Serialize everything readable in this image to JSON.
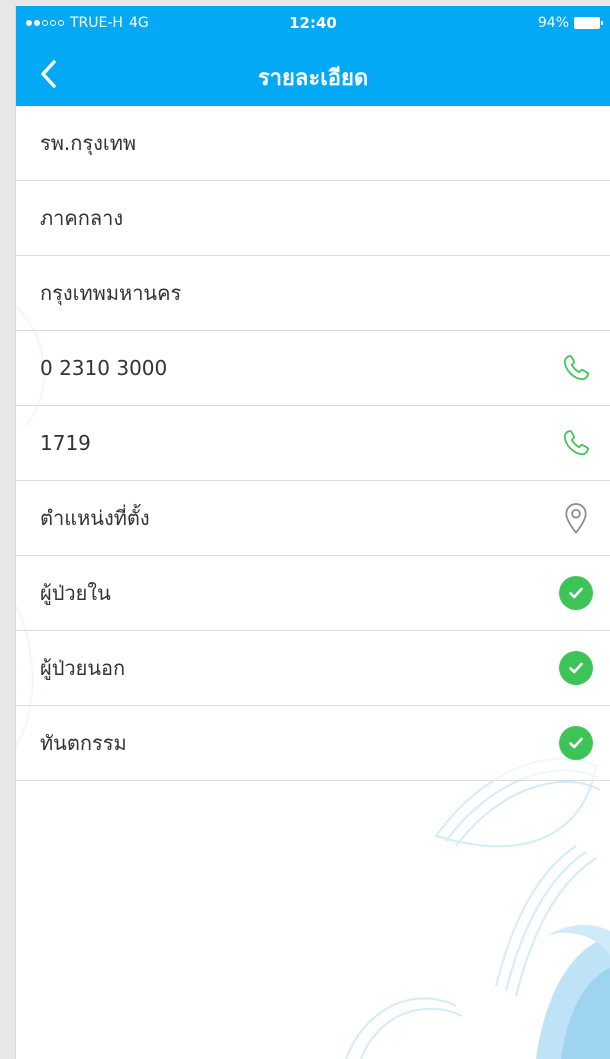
{
  "status_bar": {
    "carrier": "TRUE-H",
    "network": "4G",
    "time": "12:40",
    "battery": "94%"
  },
  "nav": {
    "title": "รายละเอียด",
    "back_icon": "chevron-left-icon"
  },
  "rows": [
    {
      "label": "รพ.กรุงเทพ",
      "icon": null
    },
    {
      "label": "ภาคกลาง",
      "icon": null
    },
    {
      "label": "กรุงเทพมหานคร",
      "icon": null
    },
    {
      "label": "0 2310 3000",
      "icon": "phone-icon"
    },
    {
      "label": "1719",
      "icon": "phone-icon"
    },
    {
      "label": "ตำแหน่งที่ตั้ง",
      "icon": "map-pin-icon"
    },
    {
      "label": "ผู้ป่วยใน",
      "icon": "check-circle-icon"
    },
    {
      "label": "ผู้ป่วยนอก",
      "icon": "check-circle-icon"
    },
    {
      "label": "ทันตกรรม",
      "icon": "check-circle-icon"
    }
  ],
  "colors": {
    "header": "#03a9f4",
    "phone_icon": "#3cc457",
    "check_icon": "#3cc457",
    "pin_icon": "#8a8a8a"
  }
}
